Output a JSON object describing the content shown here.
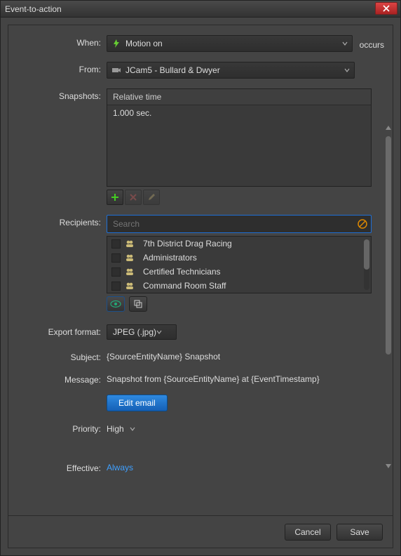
{
  "title": "Event-to-action",
  "labels": {
    "when": "When:",
    "from": "From:",
    "snapshots": "Snapshots:",
    "recipients": "Recipients:",
    "export_format": "Export format:",
    "subject": "Subject:",
    "message": "Message:",
    "priority": "Priority:",
    "effective": "Effective:"
  },
  "when": {
    "value": "Motion on",
    "suffix": "occurs"
  },
  "from": {
    "value": "JCam5 - Bullard & Dwyer"
  },
  "snapshots": {
    "column_header": "Relative time",
    "rows": [
      "1.000 sec."
    ]
  },
  "recipients": {
    "search_placeholder": "Search",
    "items": [
      "7th District Drag Racing",
      "Administrators",
      "Certified Technicians",
      "Command Room Staff"
    ]
  },
  "export_format": "JPEG (.jpg)",
  "subject": "{SourceEntityName} Snapshot",
  "message": "Snapshot from {SourceEntityName} at {EventTimestamp}",
  "edit_email_label": "Edit email",
  "priority": "High",
  "effective": "Always",
  "footer": {
    "cancel": "Cancel",
    "save": "Save"
  },
  "icons": {
    "motion": "motion-icon",
    "camera": "camera-icon",
    "group": "group-icon"
  }
}
